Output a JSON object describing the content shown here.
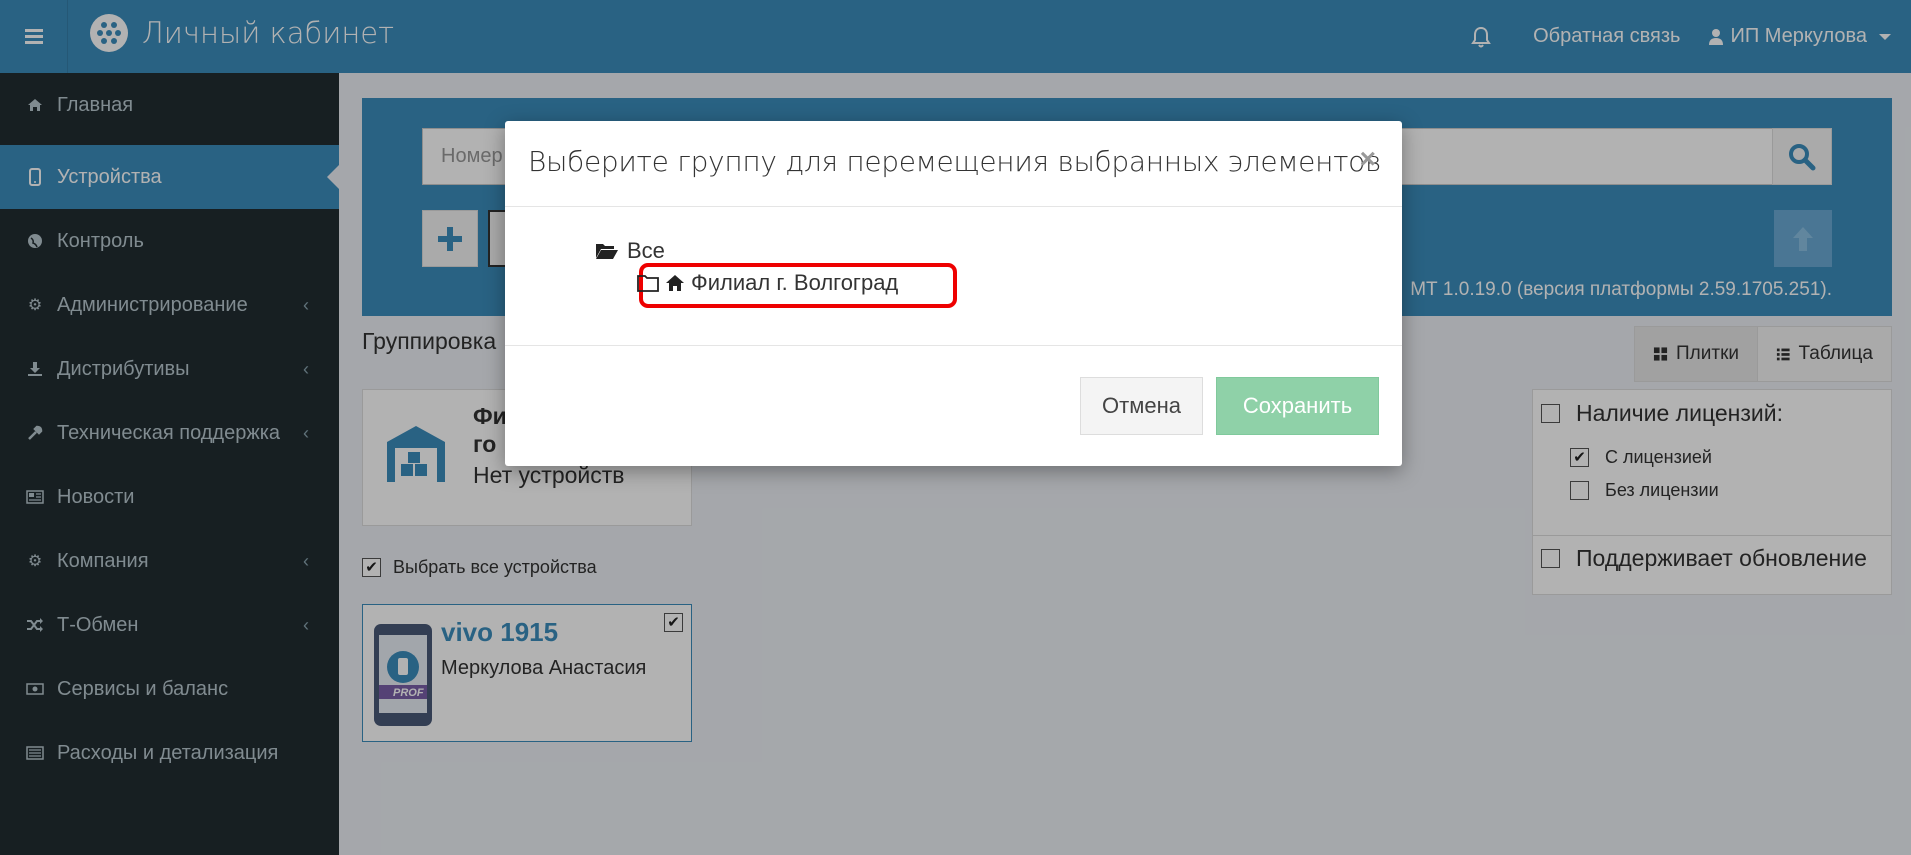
{
  "header": {
    "title": "Личный кабинет",
    "feedback": "Обратная связь",
    "user": "ИП Меркулова"
  },
  "sidebar": {
    "items": [
      {
        "label": "Главная",
        "icon": "home-icon"
      },
      {
        "label": "Устройства",
        "icon": "mobile-icon",
        "active": true
      },
      {
        "label": "Контроль",
        "icon": "globe-icon"
      },
      {
        "label": "Администрирование",
        "icon": "cogs-icon",
        "chevron": true
      },
      {
        "label": "Дистрибутивы",
        "icon": "download-icon",
        "chevron": true
      },
      {
        "label": "Техническая поддержка",
        "icon": "wrench-icon",
        "chevron": true
      },
      {
        "label": "Новости",
        "icon": "newspaper-icon"
      },
      {
        "label": "Компания",
        "icon": "gear-icon",
        "chevron": true
      },
      {
        "label": "Т-Обмен",
        "icon": "shuffle-icon",
        "chevron": true
      },
      {
        "label": "Сервисы и баланс",
        "icon": "money-icon"
      },
      {
        "label": "Расходы и детализация",
        "icon": "list-icon"
      }
    ]
  },
  "main": {
    "search_placeholder": "Номер",
    "version_text": "МТ 1.0.19.0 (версия платформы 2.59.1705.251).",
    "grouping_label": "Группировка",
    "view_tiles": "Плитки",
    "view_table": "Таблица",
    "group_card": {
      "title_line1": "Фи",
      "title_line2": "го",
      "subtitle": "Нет устройств"
    },
    "select_all_label": "Выбрать все устройства",
    "device": {
      "name": "vivo 1915",
      "owner": "Меркулова Анастасия",
      "badge": "PROF"
    },
    "filters": {
      "license_title": "Наличие лицензий:",
      "with_license": "С лицензией",
      "without_license": "Без лицензии",
      "supports_update": "Поддерживает обновление"
    }
  },
  "modal": {
    "title": "Выберите группу для перемещения выбранных элементов",
    "close_glyph": "×",
    "tree_root": "Все",
    "tree_child": "Филиал г. Волгоград",
    "cancel": "Отмена",
    "save": "Сохранить"
  },
  "colors": {
    "brand": "#3c8dbc",
    "sidebar": "#222d32",
    "save_button": "#8fd1a8",
    "highlight": "#ee0000"
  }
}
